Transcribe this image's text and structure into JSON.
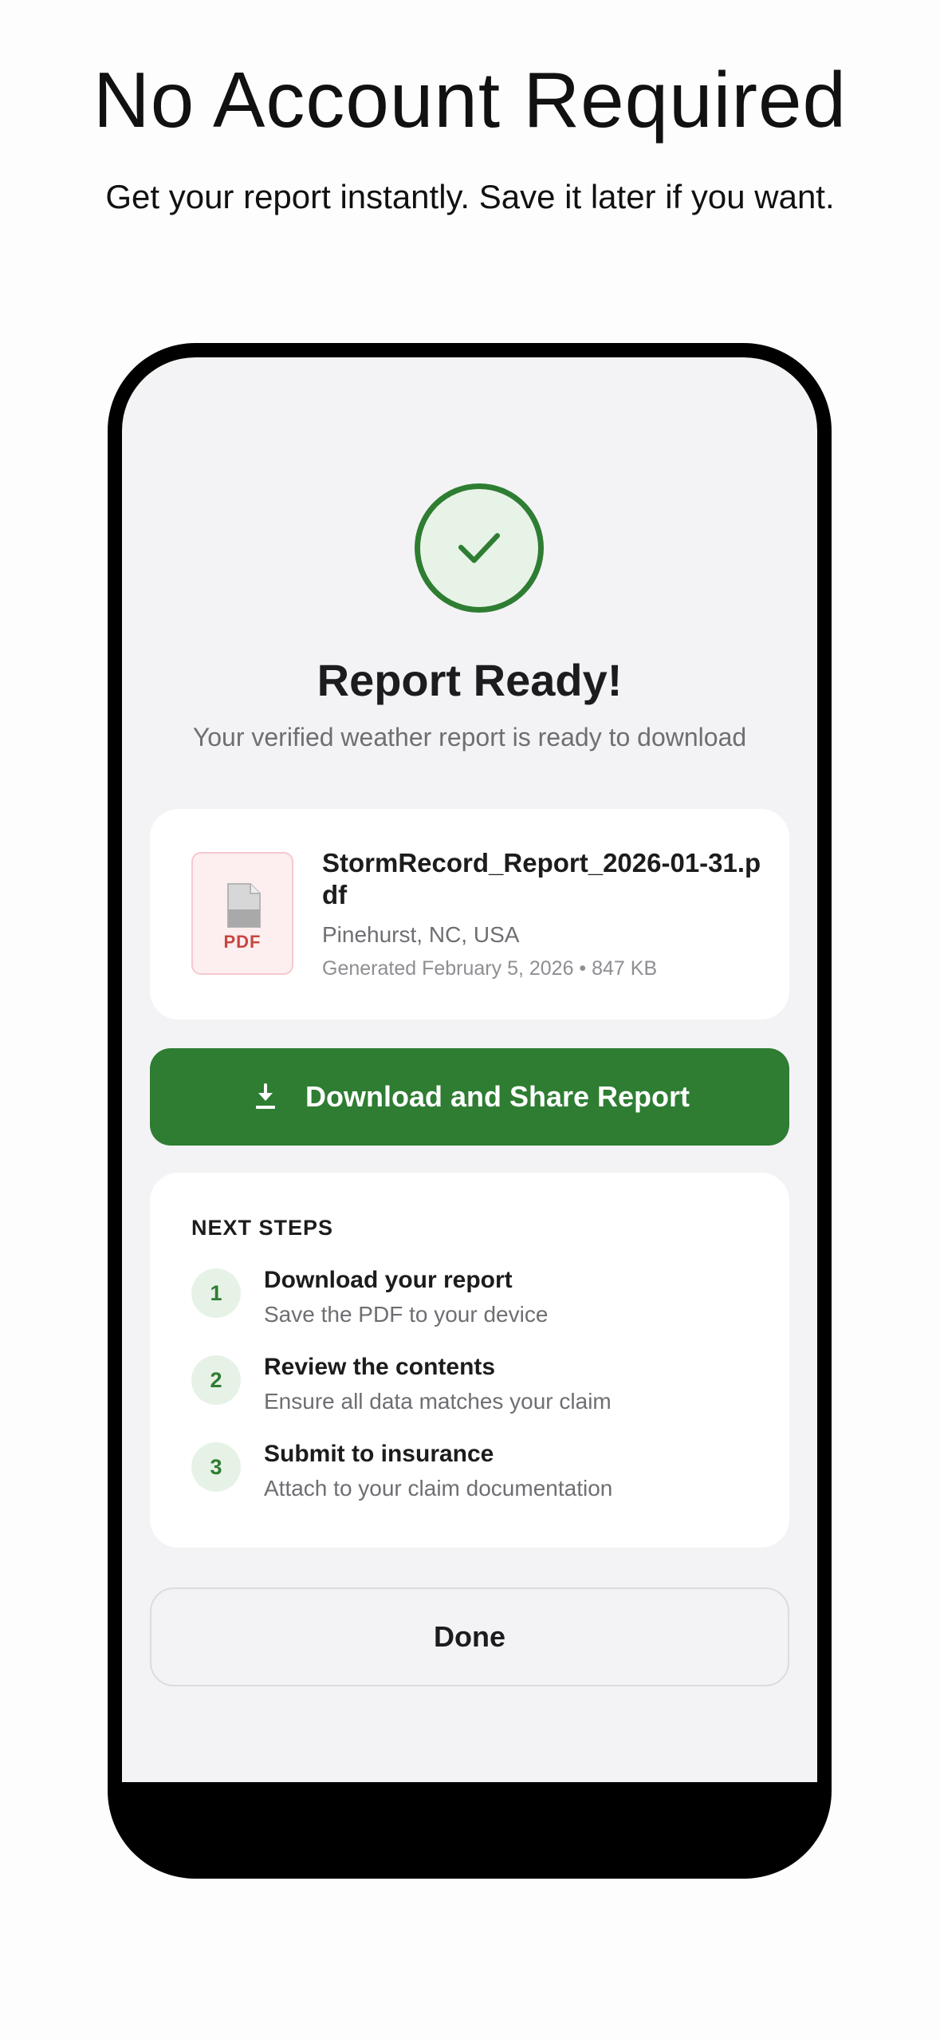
{
  "promo": {
    "title": "No Account Required",
    "subtitle": "Get your report instantly. Save it later if you want."
  },
  "screen": {
    "status_icon": "checkmark-icon",
    "title": "Report Ready!",
    "subtitle": "Your verified weather report is ready to download",
    "file": {
      "icon": "pdf-document-icon",
      "type_label": "PDF",
      "name": "StormRecord_Report_2026-01-31.pdf",
      "location": "Pinehurst, NC, USA",
      "meta": "Generated February 5, 2026 • 847 KB"
    },
    "download_button": {
      "icon": "download-icon",
      "label": "Download and Share Report"
    },
    "next_steps": {
      "heading": "NEXT STEPS",
      "items": [
        {
          "number": "1",
          "title": "Download your report",
          "description": "Save the PDF to your device"
        },
        {
          "number": "2",
          "title": "Review the contents",
          "description": "Ensure all data matches your claim"
        },
        {
          "number": "3",
          "title": "Submit to insurance",
          "description": "Attach to your claim documentation"
        }
      ]
    },
    "done_button": {
      "label": "Done"
    }
  },
  "colors": {
    "accent_green": "#2e7d32",
    "light_green": "#e8f3e8",
    "screen_background": "#f3f3f5",
    "pdf_red": "#c6463e",
    "pdf_pink": "#fdeef0"
  }
}
